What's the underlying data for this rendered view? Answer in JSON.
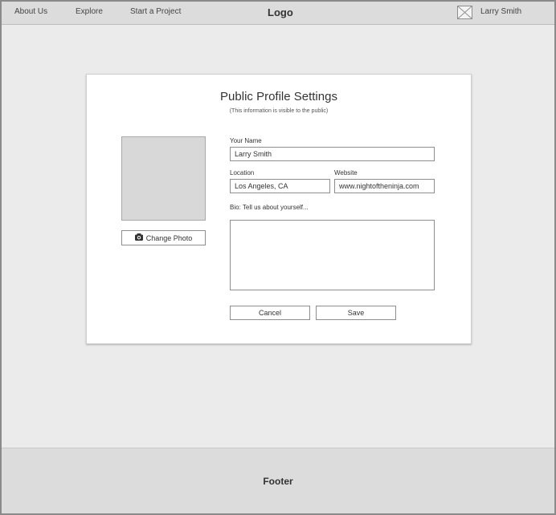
{
  "nav": {
    "links": [
      "About Us",
      "Explore",
      "Start a Project"
    ],
    "logo": "Logo",
    "user_name": "Larry Smith"
  },
  "card": {
    "title": "Public Profile Settings",
    "subtitle": "(This information is visible to the public)",
    "change_photo_label": "Change Photo",
    "fields": {
      "name_label": "Your Name",
      "name_value": "Larry Smith",
      "location_label": "Location",
      "location_value": "Los Angeles, CA",
      "website_label": "Website",
      "website_value": "www.nightoftheninja.com",
      "bio_label": "Bio: Tell us about yourself...",
      "bio_value": ""
    },
    "buttons": {
      "cancel": "Cancel",
      "save": "Save"
    }
  },
  "footer": {
    "label": "Footer"
  },
  "icons": {
    "avatar": "image-placeholder-icon",
    "camera": "camera-icon"
  }
}
